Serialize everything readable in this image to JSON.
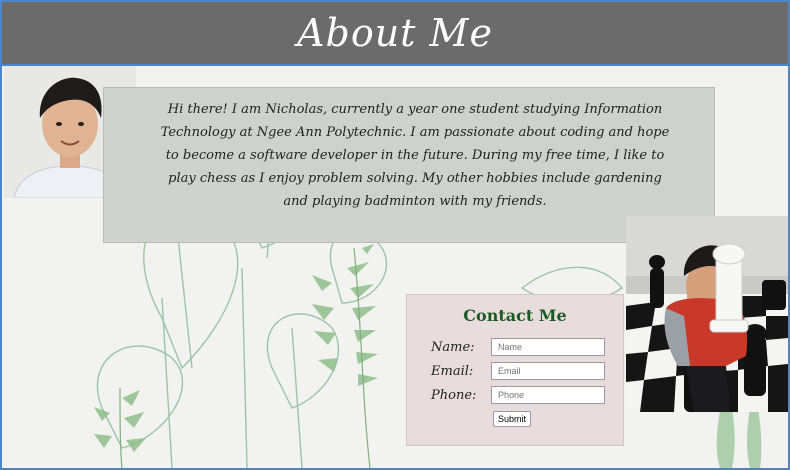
{
  "header": {
    "title": "About Me"
  },
  "bio": {
    "text": "Hi there! I am Nicholas, currently a year one student studying Information Technology at Ngee Ann Polytechnic. I am passionate about coding and hope to become a software developer in the future. During my free time, I like to play chess as I enjoy problem solving. My other hobbies include gardening and playing badminton with my friends."
  },
  "contact": {
    "title": "Contact Me",
    "name_label": "Name:",
    "name_placeholder": "Name",
    "email_label": "Email:",
    "email_placeholder": "Email",
    "phone_label": "Phone:",
    "phone_placeholder": "Phone",
    "submit_label": "Submit"
  },
  "colors": {
    "header_bg": "#6b6b6b",
    "bio_bg": "#cfd1cd",
    "contact_bg": "#e8dcdc",
    "contact_title": "#1d5a24",
    "frame_border": "#4a86c8"
  },
  "icons": [
    "leaf-background-illustration",
    "portrait-photo",
    "chess-photo"
  ]
}
